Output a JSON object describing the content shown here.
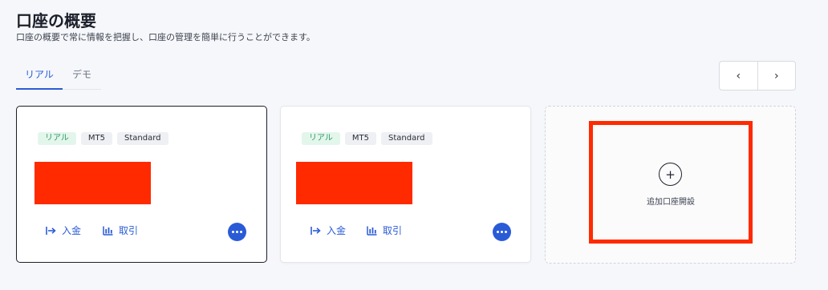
{
  "header": {
    "title": "口座の概要",
    "subtitle": "口座の概要で常に情報を把握し、口座の管理を簡単に行うことができます。"
  },
  "tabs": [
    {
      "label": "リアル",
      "active": true
    },
    {
      "label": "デモ",
      "active": false
    }
  ],
  "pager": {
    "prev_icon": "chevron-left-icon",
    "next_icon": "chevron-right-icon",
    "prev_glyph": "‹",
    "next_glyph": "›"
  },
  "accounts": [
    {
      "tags": [
        "リアル",
        "MT5",
        "Standard"
      ],
      "deposit_label": "入金",
      "trade_label": "取引",
      "selected": true
    },
    {
      "tags": [
        "リアル",
        "MT5",
        "Standard"
      ],
      "deposit_label": "入金",
      "trade_label": "取引",
      "selected": false
    }
  ],
  "add_account": {
    "plus_glyph": "+",
    "label": "追加口座開設"
  },
  "colors": {
    "accent": "#2a5bd7",
    "real_tag_bg": "#e3f6ec",
    "real_tag_text": "#2f9966",
    "redaction": "#ff2a00"
  }
}
